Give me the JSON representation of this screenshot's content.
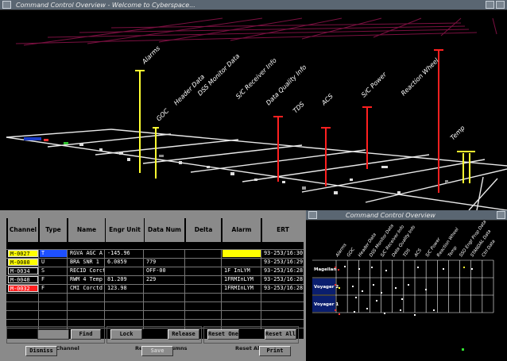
{
  "main_window": {
    "title": "Command Control Overview - Welcome to Cyberspace..."
  },
  "scene": {
    "labels": [
      "Alarms",
      "GOC",
      "Header Data",
      "DSS Monitor Data",
      "S/C Receiver Info",
      "Data Quality Info",
      "TDS",
      "ACS",
      "S/C Power",
      "Reaction Wheel",
      "Temp"
    ]
  },
  "table": {
    "headers": [
      "Channel",
      "Type",
      "Name",
      "Engr Unit",
      "Data Num",
      "Delta",
      "Alarm Value",
      "ERT"
    ],
    "rows": [
      {
        "channel": "M-0027",
        "type": "T",
        "name": "RGVA AGC A",
        "engr": "-145.96",
        "dn": "",
        "delta": "",
        "alarm": "",
        "ert": "93-253/16:30:0",
        "chan_color": "#ffff00",
        "type_color": "#1e50ff",
        "alarm_color": "#ffff00"
      },
      {
        "channel": "M-0080",
        "type": "U",
        "name": "BRA SNR 1",
        "engr": "6.0859",
        "dn": "779",
        "delta": "",
        "alarm": "",
        "ert": "93-253/16:29:0",
        "chan_color": "#ffff00",
        "type_color": "",
        "alarm_color": ""
      },
      {
        "channel": "M-0034",
        "type": "S",
        "name": "RECID Corctd",
        "engr": "",
        "dn": "OFF-00",
        "delta": "",
        "alarm": "1F  InLYM",
        "ert": "93-253/16:28:5",
        "chan_color": "",
        "type_color": "",
        "alarm_color": ""
      },
      {
        "channel": "M-0040",
        "type": "F",
        "name": "RWM 4 Temp 2",
        "engr": "81.209",
        "dn": "229",
        "delta": "",
        "alarm": "1FRMInLYM",
        "ert": "93-253/16:28:5",
        "chan_color": "",
        "type_color": "",
        "alarm_color": ""
      },
      {
        "channel": "M-0032",
        "type": "F",
        "name": "CMI Corctd",
        "engr": "123.98",
        "dn": "",
        "delta": "",
        "alarm": "1FRMInLYM",
        "ert": "93-253/16:28:5",
        "chan_color": "#ff2020",
        "type_color": "",
        "alarm_color": ""
      }
    ]
  },
  "controls": {
    "find_channel": {
      "group_label": "Find Channel",
      "field_label": "Channel:",
      "value": "",
      "button": "Find"
    },
    "relocate": {
      "group_label": "Relocate Columns",
      "lock": "Lock",
      "release": "Release"
    },
    "reset_alarm": {
      "group_label": "Reset Alarm",
      "reset_one": "Reset One",
      "reset_all": "Reset All"
    },
    "dismiss": "Dismiss",
    "save": "Save",
    "print": "Print"
  },
  "mini_window": {
    "title": "Command Control Overview",
    "spacecraft": [
      {
        "name": "Magellan",
        "color": "#000000"
      },
      {
        "name": "Voyager 2",
        "color": "#0a1e6e"
      },
      {
        "name": "Voyager 1",
        "color": "#0a1e6e"
      }
    ],
    "columns": [
      "Alarms",
      "GOC",
      "Header Data",
      "DSS Monitor Data",
      "S/C Receiver Info",
      "Data Quality Info",
      "TDS",
      "ACS",
      "S/C Power",
      "Reaction Wheel",
      "Temp",
      "SSO Engr Prop Data",
      "STANDAL Data",
      "Ctrl Data"
    ]
  }
}
